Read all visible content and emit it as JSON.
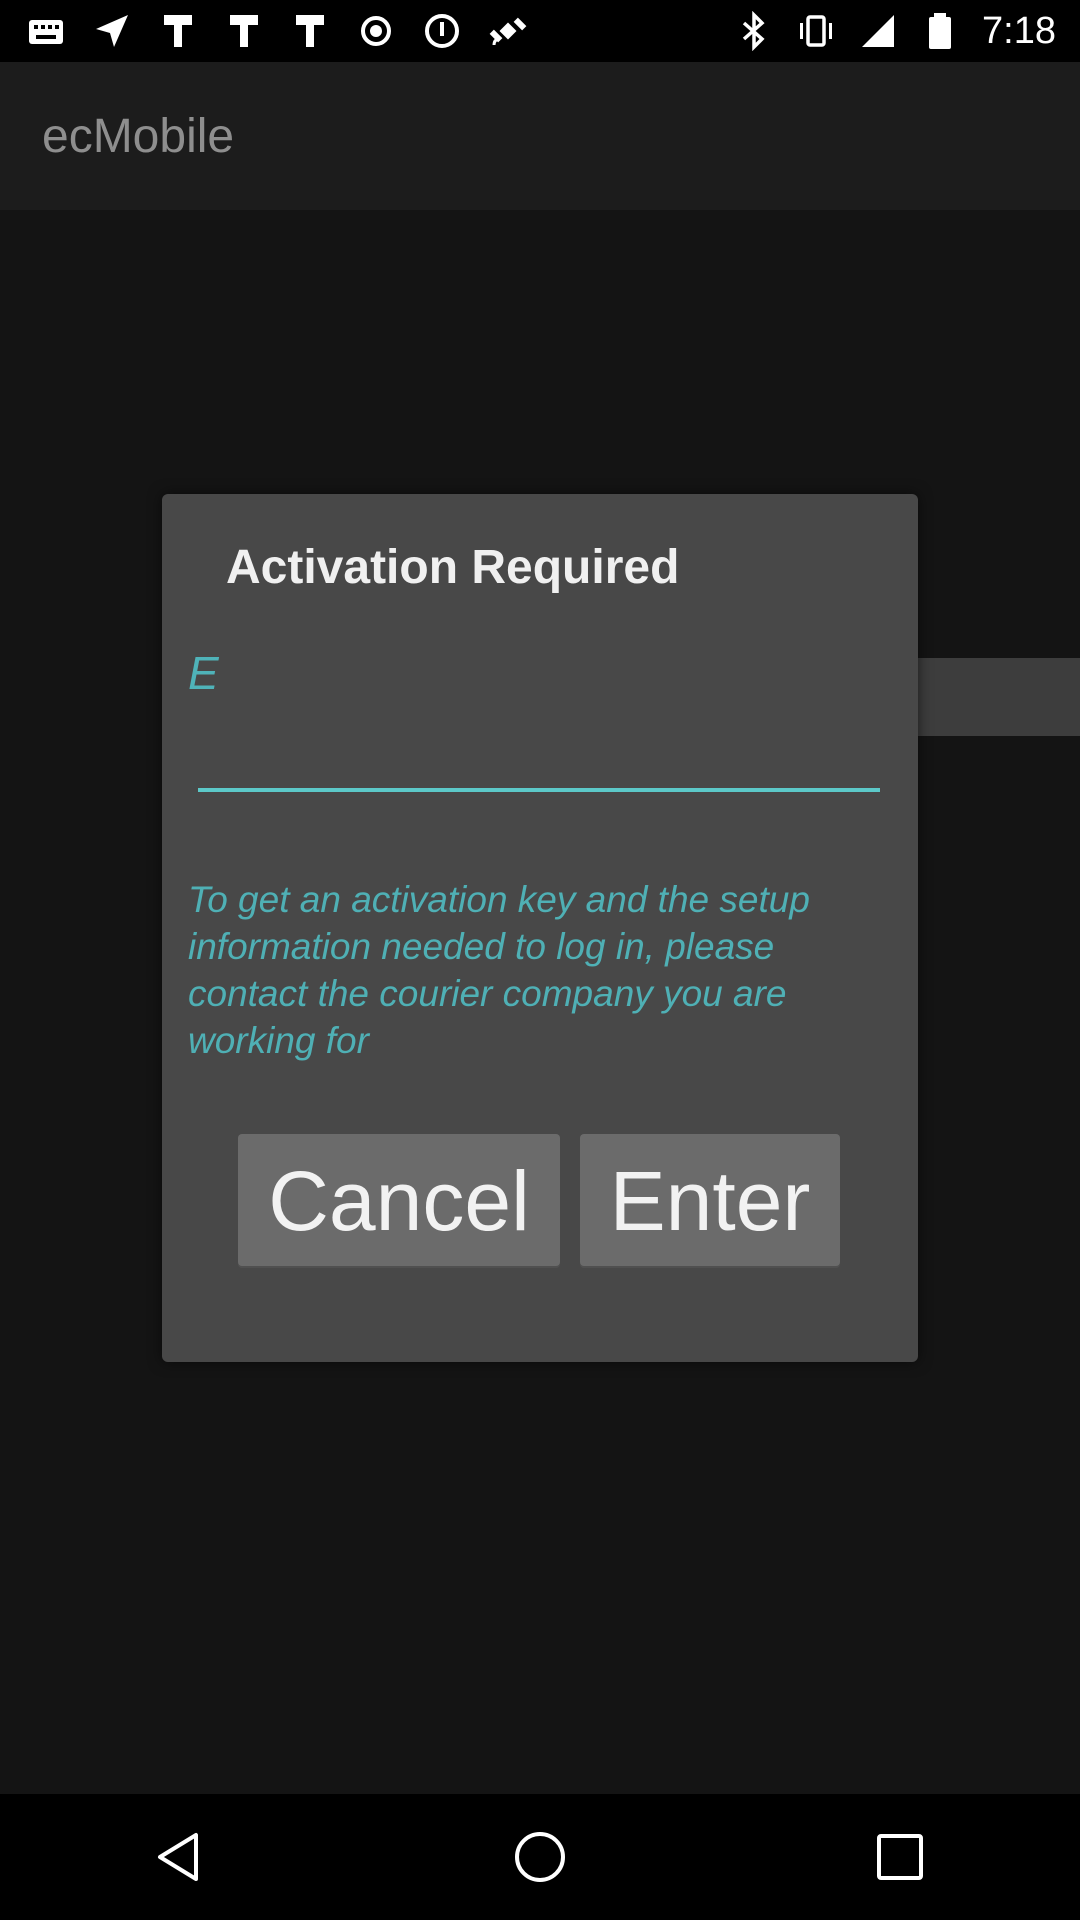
{
  "status_bar": {
    "time": "7:18",
    "left_icons": [
      "mail-icon",
      "location-arrow-icon",
      "ink-pen-icon",
      "ink-pen-icon",
      "ink-pen-icon",
      "dot-circle-icon",
      "info-circle-icon",
      "fake-gps-satellite-icon"
    ],
    "right_icons": [
      "bluetooth-icon",
      "vibrate-icon",
      "signal-icon",
      "battery-icon"
    ]
  },
  "app_bar": {
    "title": "ecMobile"
  },
  "dialog": {
    "title": "Activation Required",
    "input_hint": "E",
    "input_value": "",
    "help_text": "To get an activation key and the setup information needed to log in, please contact the courier company you are working for",
    "cancel_label": "Cancel",
    "enter_label": "Enter"
  },
  "nav": {
    "back": "back-icon",
    "home": "home-icon",
    "recents": "recents-icon"
  }
}
